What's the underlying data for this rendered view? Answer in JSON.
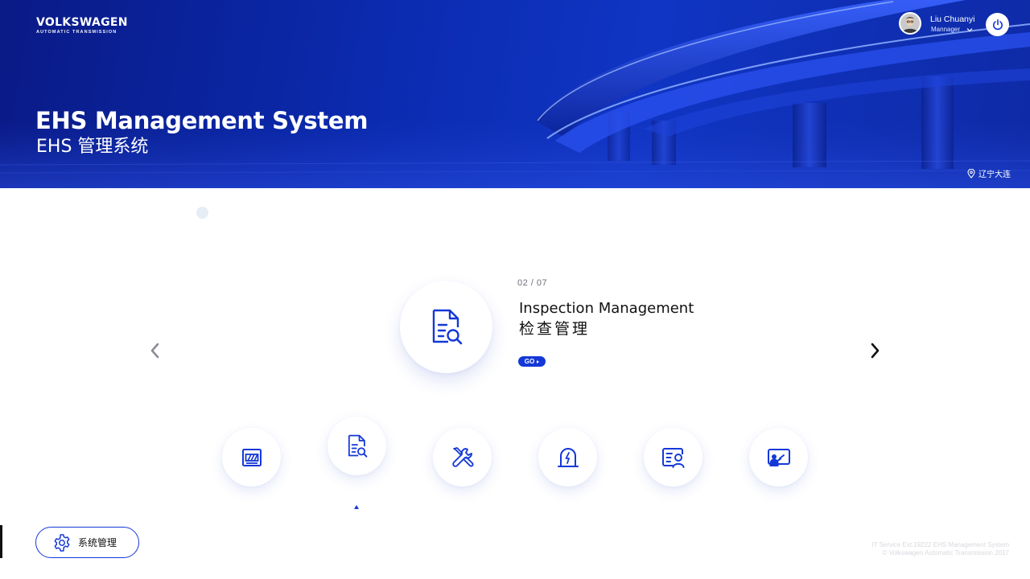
{
  "brand": {
    "name": "VOLKSWAGEN",
    "sub": "AUTOMATIC TRANSMISSION"
  },
  "hero": {
    "title": "EHS Management System",
    "subtitle": "EHS 管理系统"
  },
  "user": {
    "name": "Liu Chuanyi",
    "role": "Mannager"
  },
  "location": "辽宁大连",
  "carousel": {
    "counter": "02 / 07",
    "feature_title": "Inspection Management",
    "feature_subtitle": "检查管理",
    "go_label": "GO",
    "prev_glyph": "‹",
    "next_glyph": "›"
  },
  "modules": [
    {
      "icon": "construction-barrier-icon"
    },
    {
      "icon": "inspection-document-search-icon",
      "active": true
    },
    {
      "icon": "tools-wrench-screwdriver-icon"
    },
    {
      "icon": "alarm-light-icon"
    },
    {
      "icon": "personnel-card-icon"
    },
    {
      "icon": "training-board-icon"
    }
  ],
  "system_button": {
    "label": "系统管理",
    "icon": "gear-icon"
  },
  "footer": {
    "line1": "IT Service   Ext.19222   EHS Management System",
    "line2": "© Volkswagen Automatic Transmission 2017"
  },
  "colors": {
    "primary": "#1438d8",
    "hero_dark": "#0a1a86",
    "hero_mid": "#1035c4"
  }
}
